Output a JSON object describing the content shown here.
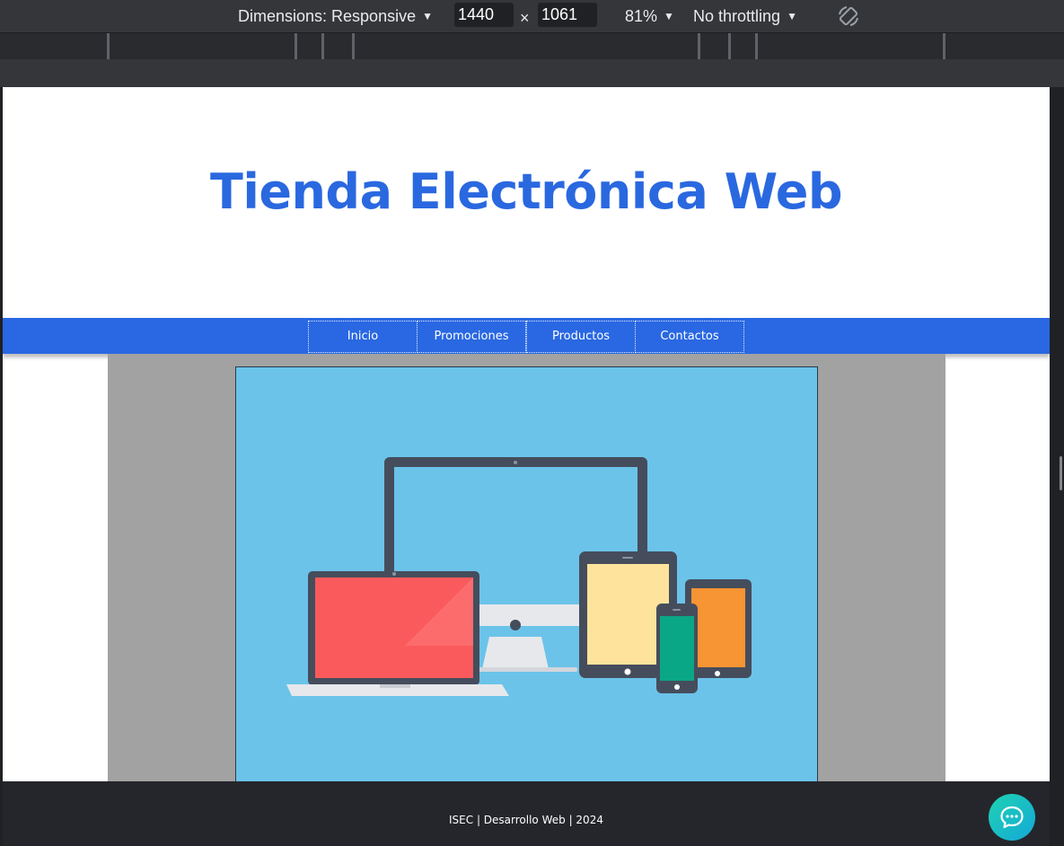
{
  "devtools": {
    "dimensions_label": "Dimensions: Responsive",
    "width_value": "1440",
    "times_symbol": "×",
    "height_value": "1061",
    "zoom_label": "81%",
    "throttling_label": "No throttling",
    "caret": "▼",
    "icons": [
      "rotate-icon"
    ]
  },
  "site": {
    "title": "Tienda Electrónica Web",
    "nav": [
      {
        "label": "Inicio"
      },
      {
        "label": "Promociones"
      },
      {
        "label": "Productos"
      },
      {
        "label": "Contactos"
      }
    ],
    "hero_image": "responsive-devices-illustration",
    "footer_text": "ISEC | Desarrollo Web | 2024",
    "chat_icon": "chat-bubble-icon"
  },
  "colors": {
    "brand_blue": "#2968e2",
    "title_blue": "#2a68e0",
    "hero_bg": "#6bc3e9",
    "footer_bg": "#25262b",
    "chat_accent": "#1fd3b2"
  }
}
